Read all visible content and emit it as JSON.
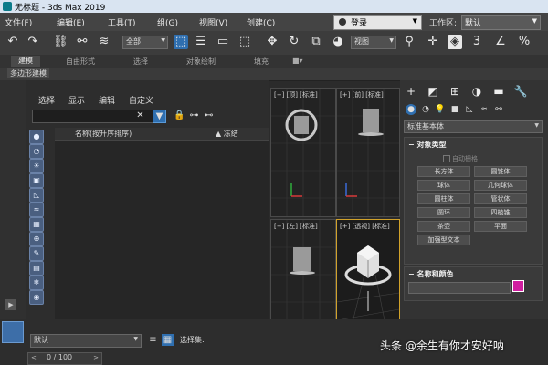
{
  "window": {
    "title": "无标题 - 3ds Max 2019"
  },
  "menu": {
    "items": [
      "文件(F)",
      "编辑(E)",
      "工具(T)",
      "组(G)",
      "视图(V)",
      "创建(C)"
    ],
    "login": "登录",
    "workspace_label": "工作区:",
    "workspace_value": "默认"
  },
  "toolbar": {
    "filter_select": "全部",
    "view_select": "视图"
  },
  "ribbon": {
    "tabs": [
      "建模",
      "自由形式",
      "选择",
      "对象绘制",
      "填充"
    ],
    "sub_label": "多边形建模"
  },
  "scene_explorer": {
    "menu": [
      "选择",
      "显示",
      "编辑",
      "自定义"
    ],
    "col_name": "名称(按升序排序)",
    "col_frozen": "▲ 冻结"
  },
  "viewports": [
    {
      "label": "[+] [顶] [标准]"
    },
    {
      "label": "[+] [前] [标准]"
    },
    {
      "label": "[+] [左] [标准]"
    },
    {
      "label": "[+] [透视] [标准]"
    }
  ],
  "command_panel": {
    "category": "标准基本体",
    "object_type": {
      "title": "对象类型",
      "autogrid": "自动栅格",
      "buttons": [
        "长方体",
        "圆锥体",
        "球体",
        "几何球体",
        "圆柱体",
        "管状体",
        "圆环",
        "四棱锥",
        "茶壶",
        "平面",
        "加强型文本"
      ]
    },
    "name_color": {
      "title": "名称和颜色"
    },
    "colors": {
      "swatch": "#d11fa0"
    }
  },
  "bottom": {
    "layer": "默认",
    "selection_set_label": "选择集:",
    "frame": "0 / 100"
  },
  "watermark": "头条 @余生有你才安好呐"
}
